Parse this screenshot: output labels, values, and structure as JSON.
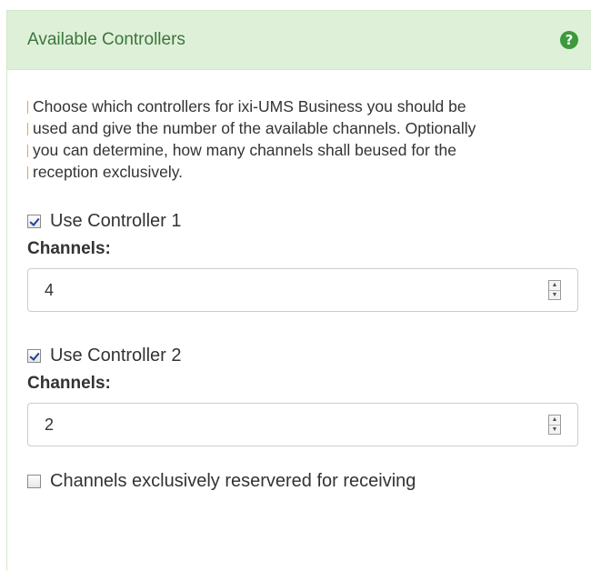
{
  "panel": {
    "title": "Available Controllers",
    "help_icon": "question-circle-icon"
  },
  "intro": {
    "lines": [
      "Choose which controllers for ixi-UMS Business you should be",
      "used and give the number of the available channels. Optionally",
      "you can determine, how many channels shall beused for the",
      "reception exclusively."
    ]
  },
  "controllers": [
    {
      "checkbox_label": "Use Controller 1",
      "checked": true,
      "channels_label": "Channels:",
      "channels_value": "4"
    },
    {
      "checkbox_label": "Use Controller 2",
      "checked": true,
      "channels_label": "Channels:",
      "channels_value": "2"
    }
  ],
  "exclusive": {
    "label": "Channels exclusively reservered for receiving",
    "checked": false
  },
  "colors": {
    "heading_bg": "#dff0d8",
    "heading_text": "#3c763d",
    "help_icon": "#3c9a3c",
    "border": "#d6e9c6"
  }
}
